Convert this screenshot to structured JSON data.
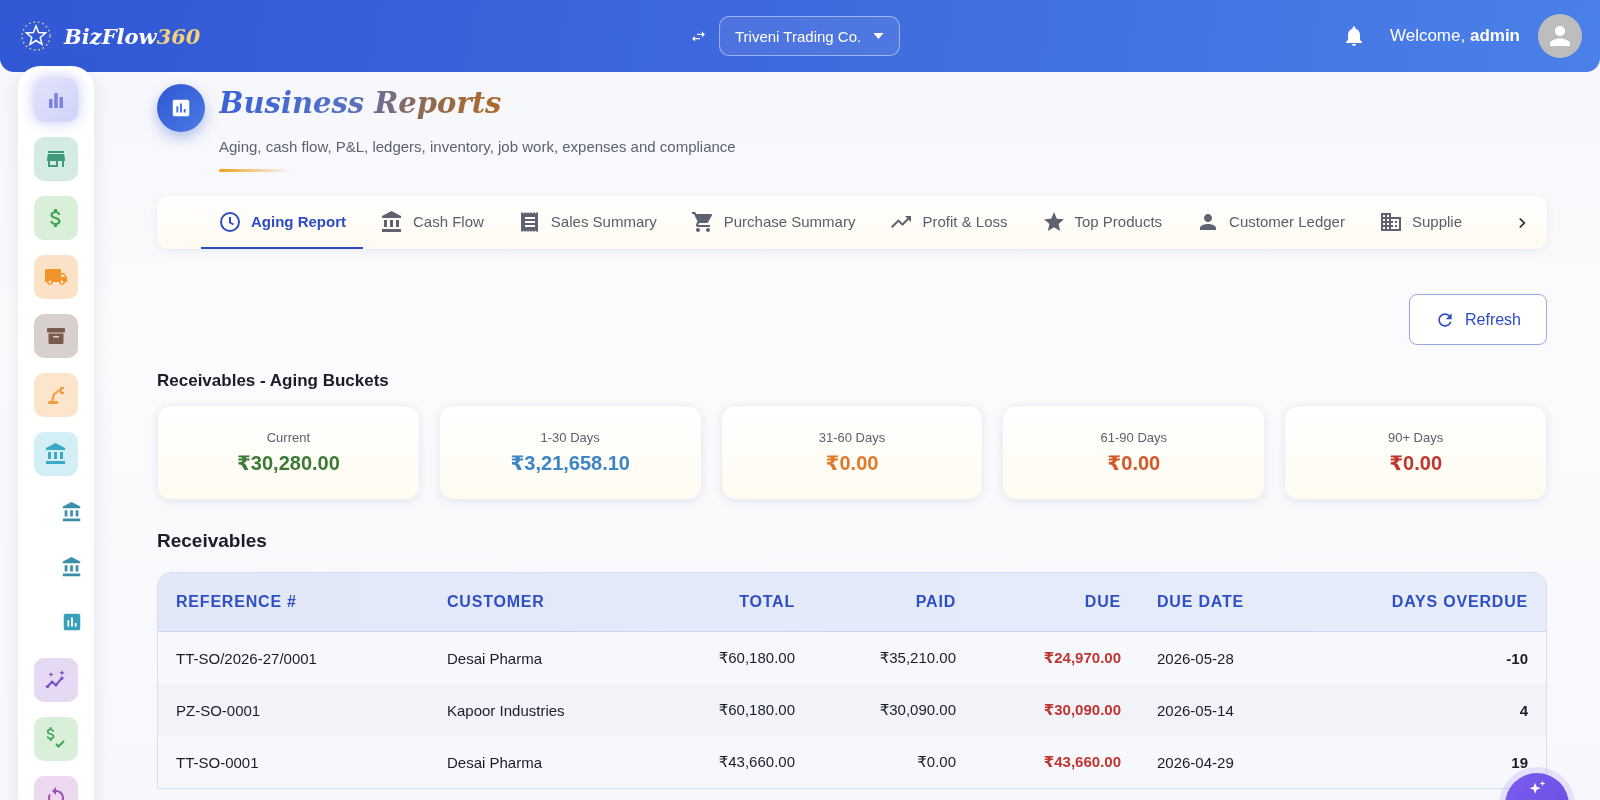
{
  "header": {
    "brand": {
      "name": "BizFlow",
      "suffix": "360"
    },
    "company": "Triveni Trading Co.",
    "welcome": "Welcome, **admin**"
  },
  "sidebar": {
    "items": [
      {
        "kind": "tile",
        "selected": true
      },
      {
        "kind": "tile",
        "selected": false
      },
      {
        "kind": "tile",
        "selected": false
      },
      {
        "kind": "tile",
        "selected": false
      },
      {
        "kind": "tile",
        "selected": false
      },
      {
        "kind": "tile",
        "selected": false
      },
      {
        "kind": "tile",
        "selected": false
      },
      {
        "kind": "sub",
        "selected": false
      },
      {
        "kind": "sub",
        "selected": false
      },
      {
        "kind": "sub",
        "selected": false
      },
      {
        "kind": "tile",
        "selected": false
      },
      {
        "kind": "tile",
        "selected": false
      },
      {
        "kind": "tile",
        "selected": false
      }
    ]
  },
  "page": {
    "title": "Business Reports",
    "subtitle": "Aging, cash flow, P&L, ledgers, inventory, job work, expenses and compliance"
  },
  "tabs": [
    {
      "label": "Aging Report",
      "selected": true
    },
    {
      "label": "Cash Flow",
      "selected": false
    },
    {
      "label": "Sales Summary",
      "selected": false
    },
    {
      "label": "Purchase Summary",
      "selected": false
    },
    {
      "label": "Profit & Loss",
      "selected": false
    },
    {
      "label": "Top Products",
      "selected": false
    },
    {
      "label": "Customer Ledger",
      "selected": false
    },
    {
      "label": "Supplie",
      "selected": false
    }
  ],
  "refresh_button": "Refresh",
  "aging": {
    "title": "Receivables - Aging Buckets",
    "buckets": [
      {
        "label": "Current",
        "value": "₹30,280.00",
        "color": "#3d7a35"
      },
      {
        "label": "1-30 Days",
        "value": "₹3,21,658.10",
        "color": "#3d86c6"
      },
      {
        "label": "31-60 Days",
        "value": "₹0.00",
        "color": "#e07a2a"
      },
      {
        "label": "61-90 Days",
        "value": "₹0.00",
        "color": "#d4572a"
      },
      {
        "label": "90+ Days",
        "value": "₹0.00",
        "color": "#c0352f"
      }
    ]
  },
  "table": {
    "title": "Receivables",
    "columns": [
      {
        "label": "REFERENCE #",
        "kind": "text"
      },
      {
        "label": "CUSTOMER",
        "kind": "text"
      },
      {
        "label": "TOTAL",
        "kind": "amount"
      },
      {
        "label": "PAID",
        "kind": "amount"
      },
      {
        "label": "DUE",
        "kind": "due"
      },
      {
        "label": "DUE DATE",
        "kind": "date"
      },
      {
        "label": "DAYS OVERDUE",
        "kind": "days"
      }
    ],
    "rows": [
      [
        "TT-SO/2026-27/0001",
        "Desai Pharma",
        "₹60,180.00",
        "₹35,210.00",
        "₹24,970.00",
        "2026-05-28",
        "-10"
      ],
      [
        "PZ-SO-0001",
        "Kapoor Industries",
        "₹60,180.00",
        "₹30,090.00",
        "₹30,090.00",
        "2026-05-14",
        "4"
      ],
      [
        "TT-SO-0001",
        "Desai Pharma",
        "₹43,660.00",
        "₹0.00",
        "₹43,660.00",
        "2026-04-29",
        "19"
      ]
    ]
  }
}
